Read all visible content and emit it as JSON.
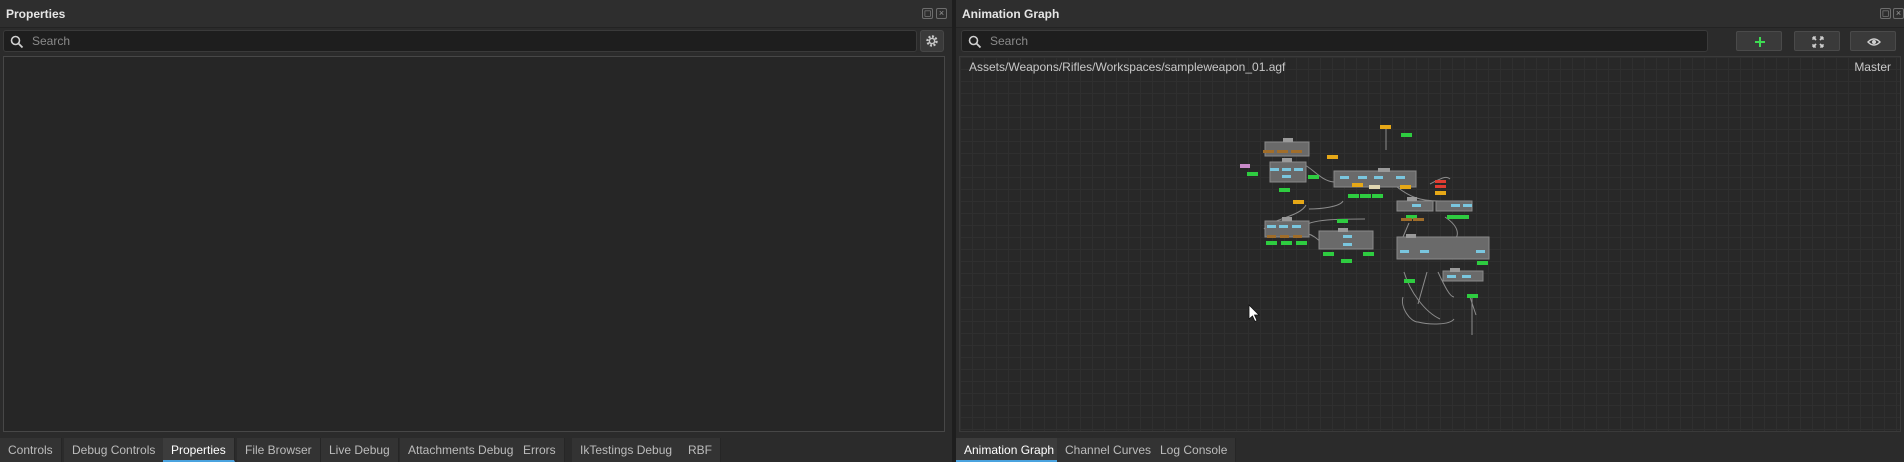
{
  "properties": {
    "title": "Properties",
    "search_placeholder": "Search",
    "tabs": [
      "Controls",
      "Debug Controls",
      "Properties",
      "File Browser",
      "Live Debug",
      "Attachments Debug",
      "Errors",
      "IkTestings Debug",
      "RBF"
    ],
    "active_tab": "Properties"
  },
  "graph": {
    "title": "Animation Graph",
    "search_placeholder": "Search",
    "path": "Assets/Weapons/Rifles/Workspaces/sampleweapon_01.agf",
    "mode": "Master",
    "tools": [
      "add-icon",
      "fit-view-icon",
      "eye-icon"
    ],
    "tabs": [
      "Animation Graph",
      "Channel Curves",
      "Log Console"
    ],
    "active_tab": "Animation Graph"
  },
  "colors": {
    "accent": "#4aa3df",
    "node": "#6a6a6a",
    "pin_green": "#2ecc40",
    "pin_yellow": "#e6a817",
    "pin_red": "#e03c31",
    "pin_brown": "#a06d2a",
    "add_green": "#3ddc52"
  }
}
